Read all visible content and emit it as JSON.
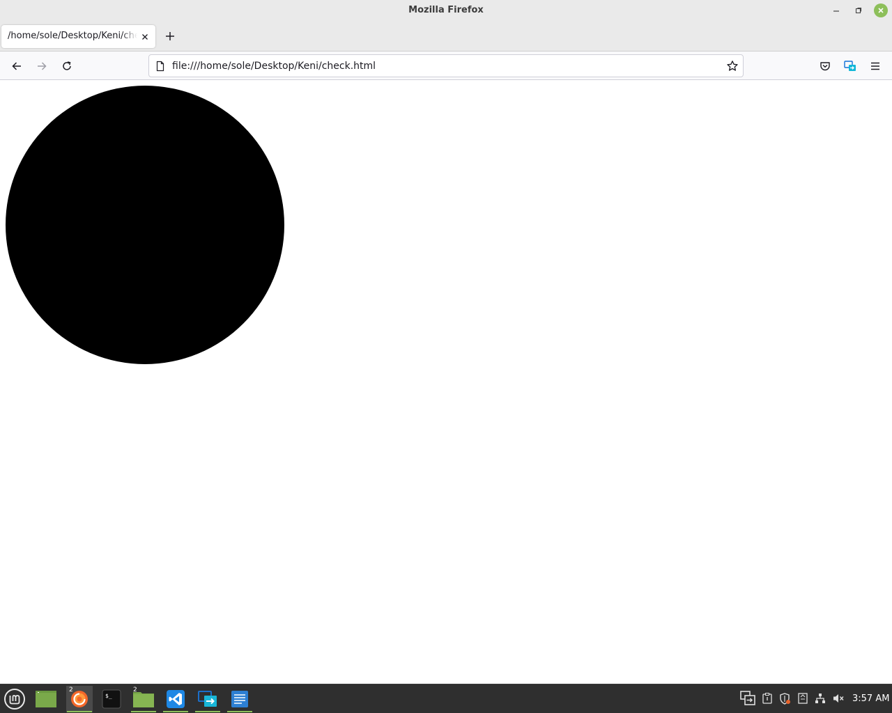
{
  "window": {
    "title": "Mozilla Firefox",
    "controls": [
      "minimize-icon",
      "maximize-icon",
      "close-icon"
    ],
    "accent_color": "#8dbf5a"
  },
  "tabs": [
    {
      "label": "/home/sole/Desktop/Keni/check.html",
      "active": true
    }
  ],
  "navbar": {
    "url": "file:///home/sole/Desktop/Keni/check.html",
    "icons": [
      "back-arrow-icon",
      "forward-arrow-icon",
      "reload-icon",
      "page-icon",
      "bookmark-star-icon",
      "pocket-icon",
      "send-tab-icon",
      "menu-icon"
    ]
  },
  "content": {
    "shape": "circle",
    "fill_color": "#000000"
  },
  "taskbar": {
    "apps": [
      {
        "name": "mint-menu-icon"
      },
      {
        "name": "show-desktop-icon"
      },
      {
        "name": "firefox-icon",
        "badge": "2",
        "active": true
      },
      {
        "name": "terminal-icon",
        "glyph": "$_"
      },
      {
        "name": "file-manager-icon",
        "badge": "2"
      },
      {
        "name": "vscode-icon"
      },
      {
        "name": "remote-desktop-icon"
      },
      {
        "name": "text-editor-icon"
      }
    ],
    "tray": [
      "remote-tray-icon",
      "clipboard-icon",
      "shield-update-icon",
      "notes-icon",
      "network-icon",
      "volume-muted-icon"
    ],
    "clock": "3:57 AM"
  }
}
